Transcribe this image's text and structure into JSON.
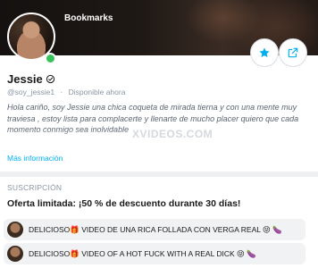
{
  "header": {
    "title": "Bookmarks"
  },
  "profile": {
    "name": "Jessie",
    "handle": "@soy_jessie1",
    "separator": "·",
    "status": "Disponible ahora",
    "bio": "Hola cariño, soy Jessie una chica coqueta de mirada tierna y con una mente muy traviesa , estoy lista para complacerte y llenarte de mucho placer quiero que cada momento conmigo sea inolvidable",
    "more_link": "Más información",
    "watermark": "XVIDEOS.COM"
  },
  "subscription": {
    "section_label": "SUSCRIPCIÓN",
    "offer": "Oferta limitada: ¡50 % de descuento durante 30 días!",
    "promos": [
      {
        "text": "DELICIOSO🎁 VIDEO DE UNA RICA FOLLADA CON VERGA REAL 😝 🍆"
      },
      {
        "text": "DELICIOSO🎁 VIDEO OF A HOT FUCK WITH A REAL DICK 😝 🍆"
      }
    ]
  },
  "icons": {
    "favorite": "star-icon",
    "share": "share-icon",
    "verified": "verified-badge-icon"
  },
  "colors": {
    "accent": "#00aff0",
    "online": "#36c25a",
    "muted": "#8a96a3"
  }
}
